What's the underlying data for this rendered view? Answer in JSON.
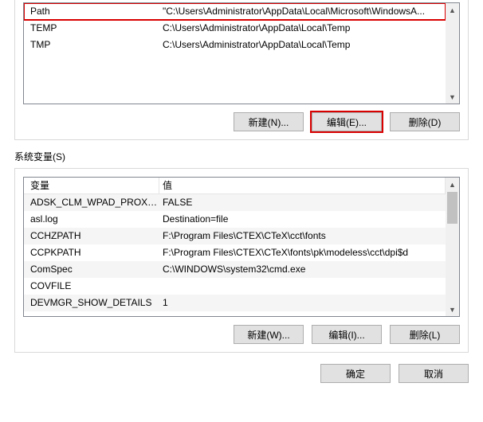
{
  "upper": {
    "rows": [
      {
        "name": "Path",
        "value": "\"C:\\Users\\Administrator\\AppData\\Local\\Microsoft\\WindowsA...",
        "hl": true
      },
      {
        "name": "TEMP",
        "value": "C:\\Users\\Administrator\\AppData\\Local\\Temp"
      },
      {
        "name": "TMP",
        "value": "C:\\Users\\Administrator\\AppData\\Local\\Temp"
      }
    ],
    "buttons": {
      "new": "新建(N)...",
      "edit": "编辑(E)...",
      "del": "删除(D)"
    }
  },
  "sys": {
    "label": "系统变量(S)",
    "header": {
      "c1": "变量",
      "c2": "值"
    },
    "rows": [
      {
        "name": "ADSK_CLM_WPAD_PROXY...",
        "value": "FALSE"
      },
      {
        "name": "asl.log",
        "value": "Destination=file"
      },
      {
        "name": "CCHZPATH",
        "value": "F:\\Program Files\\CTEX\\CTeX\\cct\\fonts"
      },
      {
        "name": "CCPKPATH",
        "value": "F:\\Program Files\\CTEX\\CTeX\\fonts\\pk\\modeless\\cct\\dpi$d"
      },
      {
        "name": "ComSpec",
        "value": "C:\\WINDOWS\\system32\\cmd.exe"
      },
      {
        "name": "COVFILE",
        "value": ""
      },
      {
        "name": "DEVMGR_SHOW_DETAILS",
        "value": "1"
      }
    ],
    "buttons": {
      "new": "新建(W)...",
      "edit": "编辑(I)...",
      "del": "删除(L)"
    }
  },
  "dialog": {
    "ok": "确定",
    "cancel": "取消"
  }
}
